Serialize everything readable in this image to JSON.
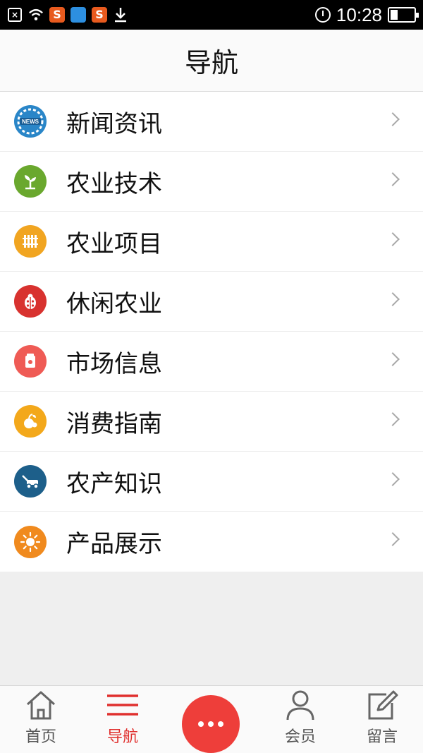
{
  "status_bar": {
    "time": "10:28",
    "left_icons": [
      "close-box-icon",
      "wifi-icon",
      "sohu-icon",
      "weather-icon",
      "sogou-icon",
      "download-icon"
    ],
    "right_icons": [
      "alarm-icon",
      "battery-icon"
    ]
  },
  "header": {
    "title": "导航"
  },
  "nav": {
    "items": [
      {
        "label": "新闻资讯",
        "icon": "news-icon",
        "color": "#2a86c8"
      },
      {
        "label": "农业技术",
        "icon": "sprout-icon",
        "color": "#6aa82e"
      },
      {
        "label": "农业项目",
        "icon": "fence-icon",
        "color": "#f1a521"
      },
      {
        "label": "休闲农业",
        "icon": "ladybug-icon",
        "color": "#d8322f"
      },
      {
        "label": "市场信息",
        "icon": "bag-icon",
        "color": "#ef5b55"
      },
      {
        "label": "消费指南",
        "icon": "fruit-icon",
        "color": "#f3a81b"
      },
      {
        "label": "农产知识",
        "icon": "lawnmower-icon",
        "color": "#1d5f8a"
      },
      {
        "label": "产品展示",
        "icon": "sun-icon",
        "color": "#f08a1e"
      }
    ]
  },
  "tabbar": {
    "home": "首页",
    "nav": "导航",
    "member": "会员",
    "message": "留言",
    "accent": "#e0302e"
  }
}
